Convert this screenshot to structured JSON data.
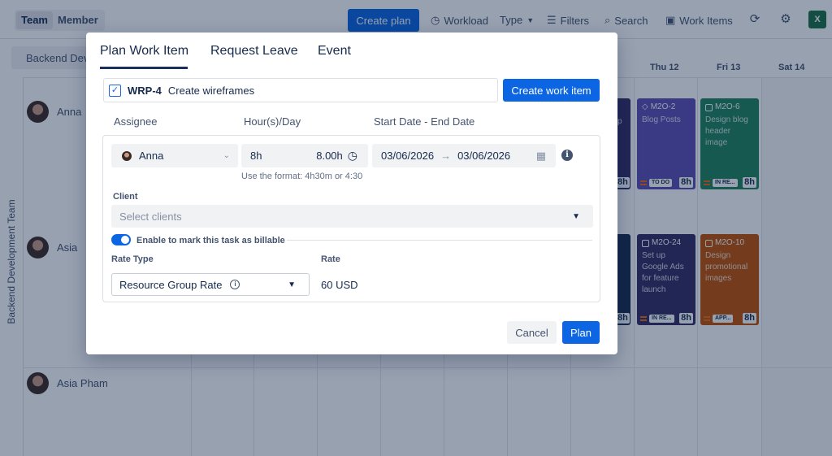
{
  "topbar": {
    "team_label": "Team",
    "member_label": "Member",
    "create_plan_label": "Create plan",
    "workload_label": "Workload",
    "type_label": "Type",
    "filters_label": "Filters",
    "search_label": "Search",
    "work_items_label": "Work Items",
    "excel_icon_text": "X"
  },
  "team_filter": {
    "label": "Backend Dev"
  },
  "calendar": {
    "days": [
      "Thu  12",
      "Fri  13",
      "Sat  14"
    ],
    "side_label": "Backend Development Team",
    "members": [
      {
        "name": "Anna"
      },
      {
        "name": "Asia"
      },
      {
        "name": "Asia Pham"
      }
    ],
    "cards": [
      {
        "key": "M2O-2",
        "title": "Blog Posts",
        "status": "TO DO",
        "hours": "8h",
        "color": "#5e4db2"
      },
      {
        "key": "M2O-6",
        "title": "Design blog header image",
        "status": "IN RE...",
        "hours": "8h",
        "color": "#1f845a"
      },
      {
        "key": "M2O-24",
        "title": "Set up Google Ads for feature launch",
        "status": "IN RE...",
        "hours": "8h",
        "color": "#352c63"
      },
      {
        "key": "M2O-10",
        "title": "Design promotional images",
        "status": "APP...",
        "hours": "8h",
        "color": "#c25100"
      },
      {
        "key": "",
        "title": "",
        "status": "",
        "hours": "8h",
        "color": "#352c63"
      },
      {
        "key": "",
        "title": "",
        "status": "",
        "hours": "8h",
        "color": "#172b4d"
      }
    ],
    "partial_texts": [
      "p",
      "e",
      "er",
      "re"
    ]
  },
  "modal": {
    "tabs": [
      "Plan Work Item",
      "Request Leave",
      "Event"
    ],
    "active_tab": "Plan Work Item",
    "work_item": {
      "key": "WRP-4",
      "title": "Create wireframes"
    },
    "create_work_item_label": "Create work item",
    "columns": {
      "assignee": "Assignee",
      "hours": "Hour(s)/Day",
      "dates": "Start Date - End Date"
    },
    "assignee": "Anna",
    "hours_input": "8h",
    "hours_value": "8.00h",
    "hours_hint": "Use the format: 4h30m or 4:30",
    "start_date": "03/06/2026",
    "end_date": "03/06/2026",
    "client_label": "Client",
    "client_placeholder": "Select clients",
    "billable_label": "Enable to mark this task as billable",
    "billable_on": true,
    "rate_type_label": "Rate Type",
    "rate_type_value": "Resource Group Rate",
    "rate_label": "Rate",
    "rate_value": "60 USD",
    "cancel_label": "Cancel",
    "plan_label": "Plan"
  },
  "colors": {
    "primary": "#0c66e4",
    "dark_navy": "#1d2d5e",
    "excel_green": "#1d6f42"
  }
}
